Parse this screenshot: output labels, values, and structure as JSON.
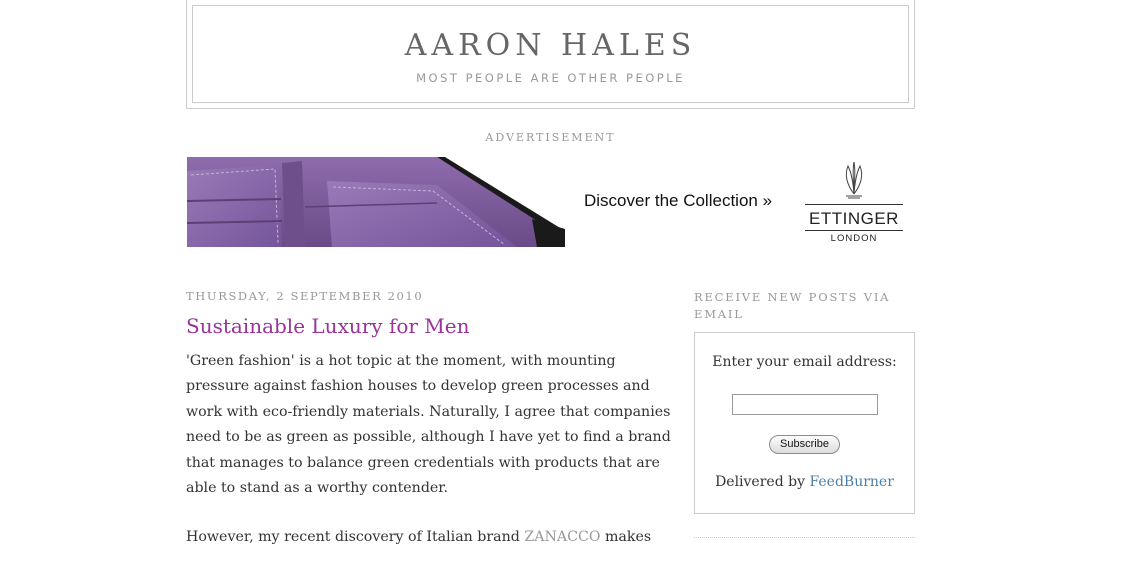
{
  "header": {
    "title": "AARON HALES",
    "description": "MOST PEOPLE ARE OTHER PEOPLE"
  },
  "ad": {
    "label": "ADVERTISEMENT",
    "cta": "Discover the Collection »",
    "brand_name": "ETTINGER",
    "brand_city": "LONDON"
  },
  "post": {
    "date": "THURSDAY, 2 SEPTEMBER 2010",
    "title": "Sustainable Luxury for Men",
    "paragraph1": "'Green fashion' is a hot topic at the moment, with mounting pressure against fashion houses to develop green processes and work with eco-friendly materials. Naturally, I agree that companies need to be as green as possible, although I have yet to find a brand that manages to balance green credentials with products that are able to stand as a worthy contender.",
    "paragraph2_before": "However, my recent discovery of Italian brand ",
    "paragraph2_link": "ZANACCO",
    "paragraph2_after": " makes"
  },
  "sidebar": {
    "heading": "RECEIVE NEW POSTS VIA EMAIL",
    "email_label": "Enter your email address:",
    "email_value": "",
    "subscribe_label": "Subscribe",
    "delivered_prefix": "Delivered by ",
    "delivered_link": "FeedBurner"
  },
  "colors": {
    "post_title": "#993399",
    "link": "#4c7fa8",
    "muted": "#999999",
    "wallet_purple": "#7d5a9a"
  }
}
